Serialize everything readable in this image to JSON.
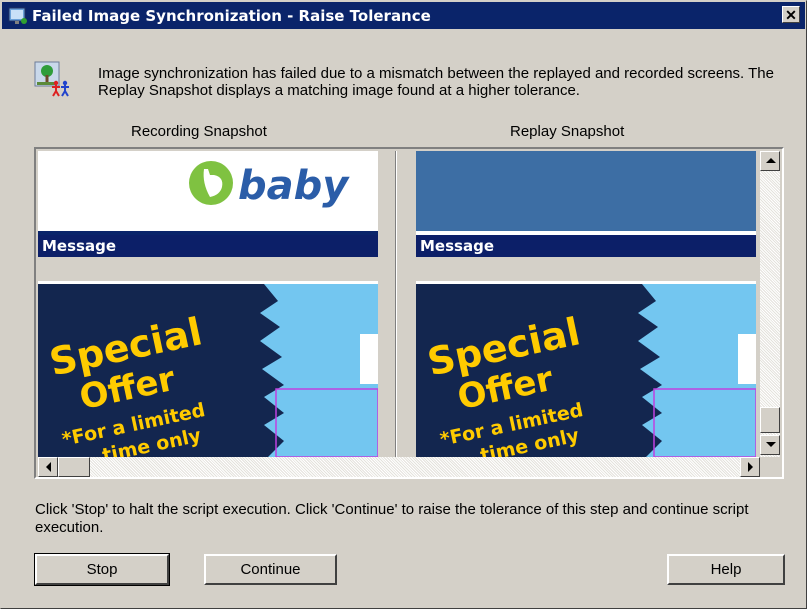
{
  "window": {
    "title": "Failed Image Synchronization - Raise Tolerance",
    "close_label": "✕"
  },
  "message": "Image synchronization has failed due to a mismatch between the replayed and recorded screens.  The Replay Snapshot displays a matching image found at a higher tolerance.",
  "recording": {
    "label": "Recording Snapshot",
    "logo_text": "baby",
    "header_text": "Message",
    "offer_line1": "Special",
    "offer_line2": "Offer",
    "offer_line3": "*For a limited",
    "offer_line4": "time only"
  },
  "replay": {
    "label": "Replay Snapshot",
    "header_text": "Message",
    "offer_line1": "Special",
    "offer_line2": "Offer",
    "offer_line3": "*For a limited",
    "offer_line4": "time only"
  },
  "instructions": "Click 'Stop' to halt the script execution. Click 'Continue' to raise the tolerance of this step and continue script execution.",
  "buttons": {
    "stop": "Stop",
    "continue": "Continue",
    "help": "Help"
  },
  "colors": {
    "titlebar": "#0a246a",
    "dialog": "#d4d0c8",
    "banner_blue": "#3d6ea4",
    "header_navy": "#0c1f68",
    "offer_dark": "#13264f",
    "offer_yellow": "#ffcb00",
    "sky_blue": "#73c6f0"
  }
}
